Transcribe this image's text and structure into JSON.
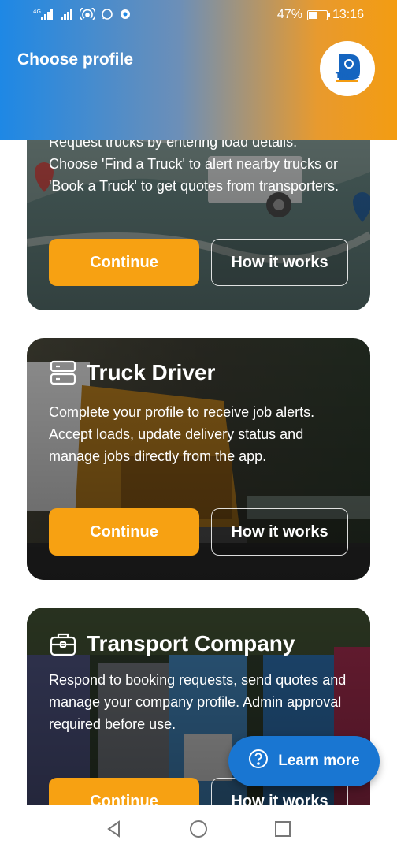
{
  "status_bar": {
    "network_1": "4G",
    "signal_2": "4G",
    "battery_percent": "47%",
    "battery_level": 0.47,
    "time": "13:16"
  },
  "header": {
    "title": "Choose profile",
    "logo_text": "Truck",
    "logo_icon": "truck-logo-icon"
  },
  "cards": [
    {
      "title": "",
      "description": "Request trucks by entering load details. Choose 'Find a Truck' to alert nearby trucks or 'Book a Truck' to get quotes from transporters.",
      "continue_label": "Continue",
      "how_label": "How it works"
    },
    {
      "title": "Truck Driver",
      "icon": "id-card-icon",
      "description": "Complete your profile to receive job alerts. Accept loads, update delivery status and manage jobs directly from the app.",
      "continue_label": "Continue",
      "how_label": "How it works"
    },
    {
      "title": "Transport Company",
      "icon": "briefcase-icon",
      "description": "Respond to booking requests, send quotes and manage your company profile. Admin approval required before use.",
      "continue_label": "Continue",
      "how_label": "How it works"
    }
  ],
  "fab": {
    "label": "Learn more",
    "icon": "help-circle-icon"
  },
  "colors": {
    "accent_orange": "#F7A112",
    "primary_blue": "#1976D2",
    "header_start": "#1E88E5",
    "header_end": "#F39C12"
  },
  "nav": {
    "back_icon": "back-triangle-icon",
    "home_icon": "home-circle-icon",
    "recent_icon": "recent-square-icon"
  }
}
